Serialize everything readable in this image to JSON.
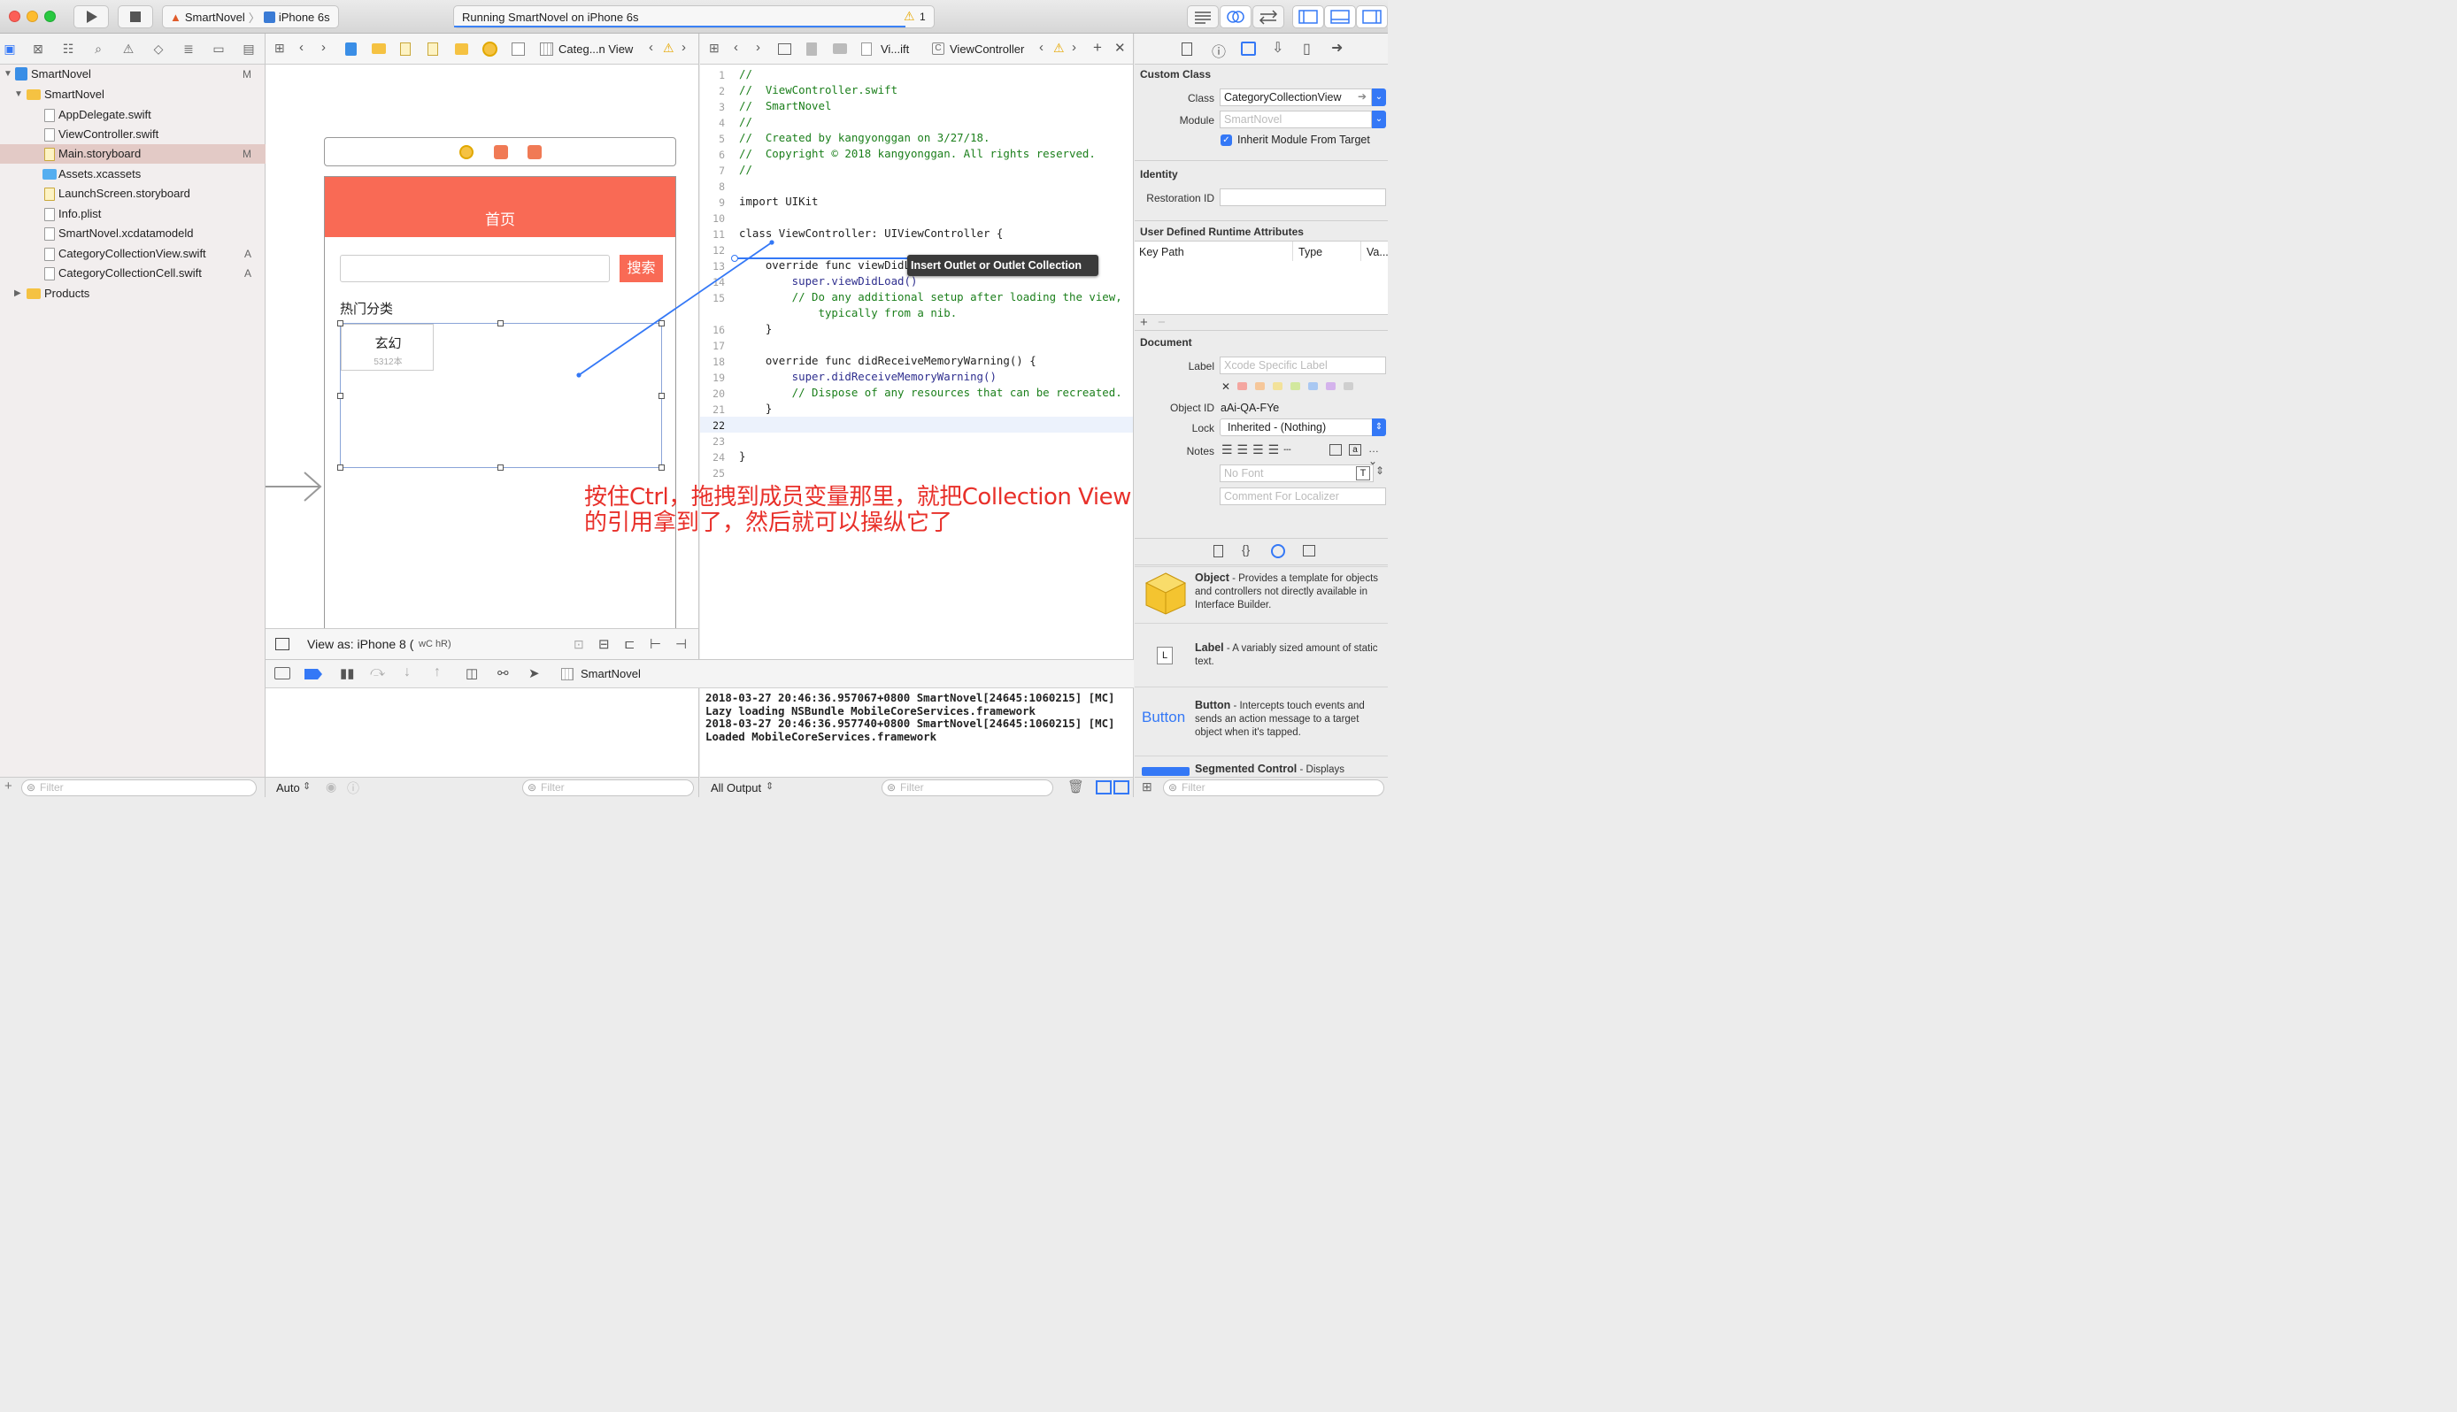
{
  "toolbar": {
    "scheme_app": "SmartNovel",
    "scheme_device": "iPhone 6s",
    "activity_status": "Running SmartNovel on iPhone 6s",
    "warning_count": "1"
  },
  "navigator": {
    "items": [
      {
        "label": "SmartNovel",
        "badge": "M"
      },
      {
        "label": "SmartNovel",
        "badge": ""
      },
      {
        "label": "AppDelegate.swift",
        "badge": ""
      },
      {
        "label": "ViewController.swift",
        "badge": ""
      },
      {
        "label": "Main.storyboard",
        "badge": "M"
      },
      {
        "label": "Assets.xcassets",
        "badge": ""
      },
      {
        "label": "LaunchScreen.storyboard",
        "badge": ""
      },
      {
        "label": "Info.plist",
        "badge": ""
      },
      {
        "label": "SmartNovel.xcdatamodeld",
        "badge": ""
      },
      {
        "label": "CategoryCollectionView.swift",
        "badge": "A"
      },
      {
        "label": "CategoryCollectionCell.swift",
        "badge": "A"
      },
      {
        "label": "Products",
        "badge": ""
      }
    ],
    "filter_placeholder": "Filter"
  },
  "ib_jumpbar": {
    "current": "Categ...n View"
  },
  "editor_jumpbar": {
    "file": "Vi...ift",
    "symbol": "ViewController"
  },
  "storyboard": {
    "nav_title": "首页",
    "search_button": "搜索",
    "section_title": "热门分类",
    "cell_title": "玄幻",
    "cell_subtitle": "5312本",
    "view_as": "View as: iPhone 8 (",
    "view_as_size": "wC hR)"
  },
  "code": {
    "lines": [
      "//",
      "//  ViewController.swift",
      "//  SmartNovel",
      "//",
      "//  Created by kangyonggan on 3/27/18.",
      "//  Copyright © 2018 kangyonggan. All rights reserved.",
      "//",
      "",
      "import UIKit",
      "",
      "class ViewController: UIViewController {",
      "",
      "    override func viewDidLoad() {",
      "        super.viewDidLoad()",
      "        // Do any additional setup after loading the view,",
      "            typically from a nib.",
      "    }",
      "",
      "    override func didReceiveMemoryWarning() {",
      "        super.didReceiveMemoryWarning()",
      "        // Dispose of any resources that can be recreated.",
      "    }",
      "",
      "",
      "}",
      ""
    ],
    "line_numbers": [
      "1",
      "2",
      "3",
      "4",
      "5",
      "6",
      "7",
      "8",
      "9",
      "10",
      "11",
      "12",
      "13",
      "14",
      "15",
      "",
      "16",
      "17",
      "18",
      "19",
      "20",
      "21",
      "22",
      "23",
      "24",
      "25"
    ],
    "tooltip": "Insert Outlet or Outlet Collection"
  },
  "annotation": {
    "line1": "按住Ctrl，拖拽到成员变量那里，就把Collection View",
    "line2": "的引用拿到了，然后就可以操纵它了"
  },
  "debug": {
    "target": "SmartNovel",
    "variables_mode": "Auto",
    "output_mode": "All Output"
  },
  "console_lines": [
    "2018-03-27 20:46:36.957067+0800 SmartNovel[24645:1060215] [MC]",
    "Lazy loading NSBundle MobileCoreServices.framework",
    "2018-03-27 20:46:36.957740+0800 SmartNovel[24645:1060215] [MC]",
    "Loaded MobileCoreServices.framework"
  ],
  "inspector": {
    "custom_class_header": "Custom Class",
    "class_label": "Class",
    "class_value": "CategoryCollectionView",
    "module_label": "Module",
    "module_placeholder": "SmartNovel",
    "inherit_label": "Inherit Module From Target",
    "identity_header": "Identity",
    "restoration_label": "Restoration ID",
    "runtime_header": "User Defined Runtime Attributes",
    "col_keypath": "Key Path",
    "col_type": "Type",
    "col_value": "Va...",
    "document_header": "Document",
    "doc_label_label": "Label",
    "doc_label_placeholder": "Xcode Specific Label",
    "object_id_label": "Object ID",
    "object_id_value": "aAi-QA-FYe",
    "lock_label": "Lock",
    "lock_value": "Inherited - (Nothing)",
    "notes_label": "Notes",
    "font_placeholder": "No Font",
    "comment_placeholder": "Comment For Localizer",
    "color_tags": [
      "#f4a6a0",
      "#f6c79a",
      "#f3e29a",
      "#d2e89e",
      "#a9c8f2",
      "#d4b3ec",
      "#cfcfcf"
    ]
  },
  "library": [
    {
      "name": "Object",
      "desc": " - Provides a template for objects and controllers not directly available in Interface Builder."
    },
    {
      "name": "Label",
      "desc": " - A variably sized amount of static text."
    },
    {
      "name": "Button",
      "desc": " - Intercepts touch events and sends an action message to a target object when it's tapped.",
      "preview": "Button"
    },
    {
      "name": "Segmented Control",
      "desc": " - Displays"
    }
  ],
  "library_filter": "Filter",
  "colors": {
    "accent": "#3478f6",
    "nav_bar": "#f96a55",
    "annotation": "#e8302a",
    "selection": "#e3cac6"
  }
}
